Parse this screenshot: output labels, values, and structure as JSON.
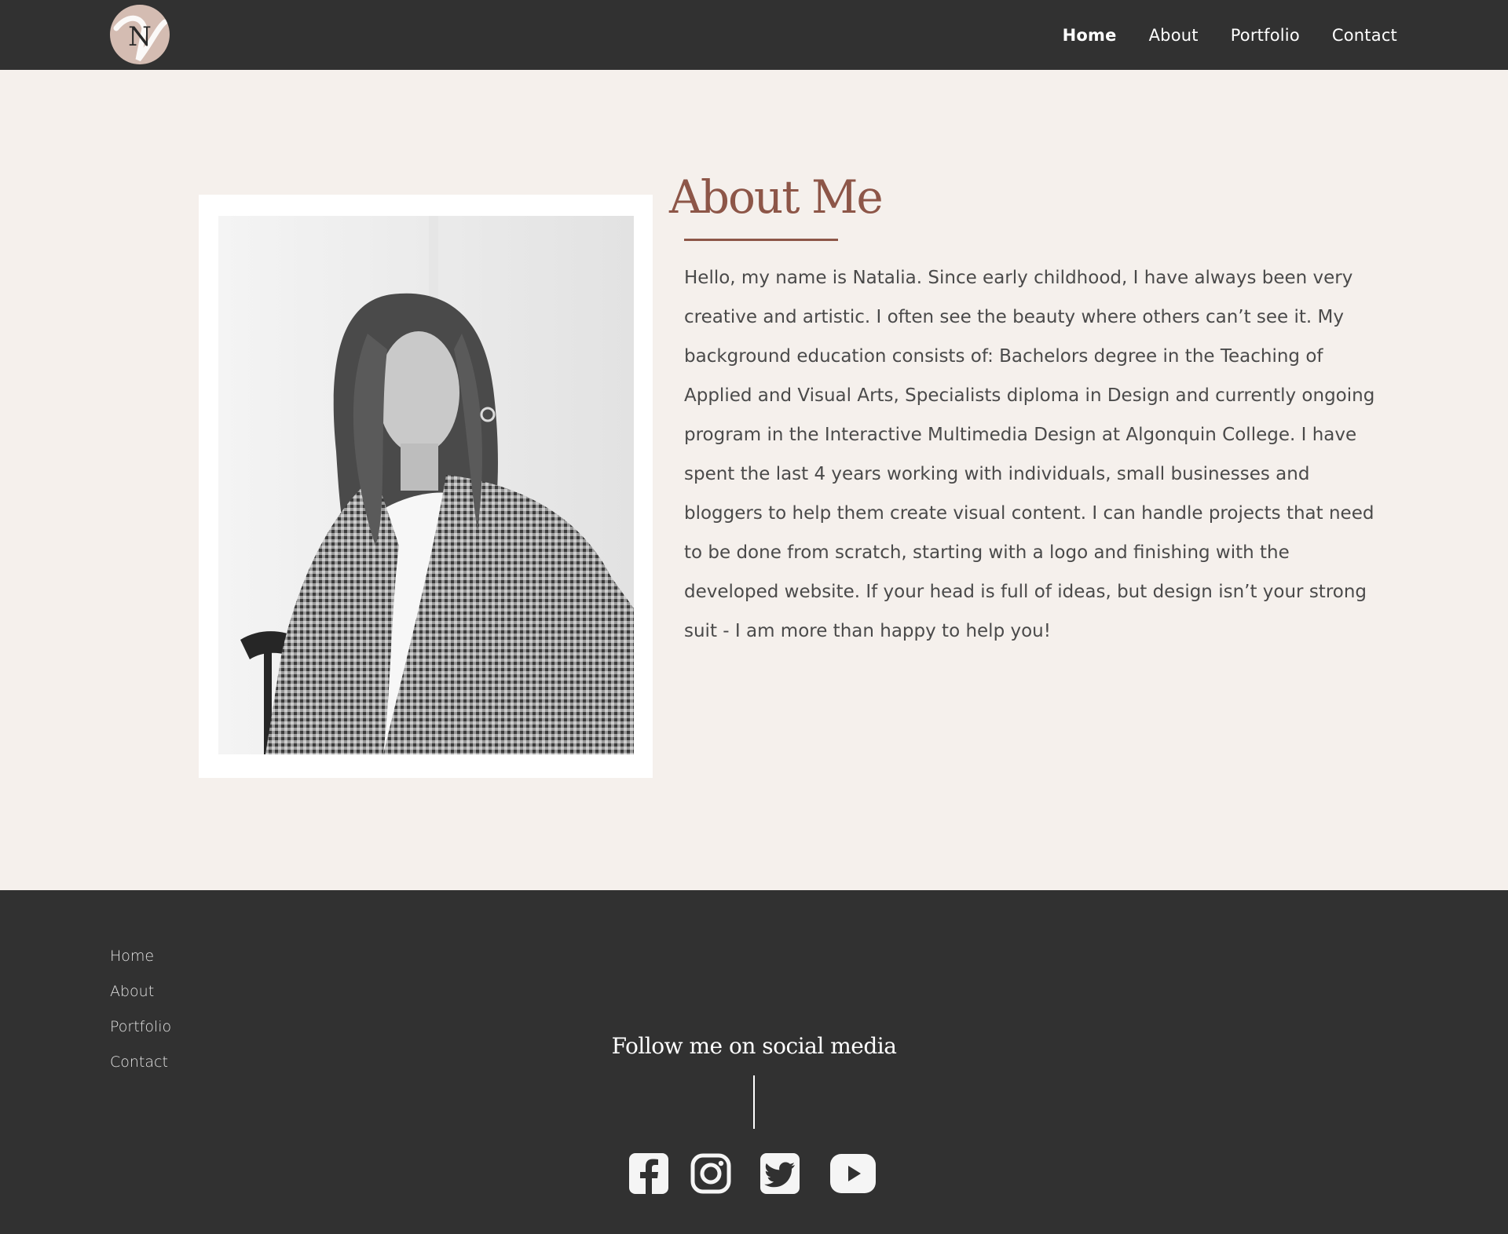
{
  "header": {
    "logo_letter": "N",
    "nav": [
      {
        "label": "Home",
        "active": true
      },
      {
        "label": "About",
        "active": false
      },
      {
        "label": "Portfolio",
        "active": false
      },
      {
        "label": "Contact",
        "active": false
      }
    ]
  },
  "about": {
    "title": "About Me",
    "bio": "Hello, my name is Natalia. Since early childhood, I have always been very creative and artistic. I often see the beauty where others can’t see it. My background education consists of: Bachelors degree in the Teaching of Applied and Visual Arts, Specialists diploma in Design and currently ongoing program in the Interactive Multimedia Design at Algonquin College. I have spent the last 4 years working with individuals, small businesses and bloggers to help them create visual content. I can handle projects that need to be done from scratch, starting with a logo and finishing with the developed website. If your head is full of ideas, but design isn’t your strong suit - I am more than happy to help you!",
    "photo_icon": "portrait-photo"
  },
  "footer": {
    "nav": [
      {
        "label": "Home"
      },
      {
        "label": "About"
      },
      {
        "label": "Portfolio"
      },
      {
        "label": "Contact"
      }
    ],
    "follow_title": "Follow me on social media",
    "social": [
      {
        "icon": "facebook-icon"
      },
      {
        "icon": "instagram-icon"
      },
      {
        "icon": "twitter-icon"
      },
      {
        "icon": "youtube-icon"
      }
    ]
  },
  "colors": {
    "dark": "#313131",
    "background": "#f5f0ec",
    "accent": "#8d5648",
    "logo_bg": "#d4bcb2",
    "text": "#4a4a4a"
  }
}
